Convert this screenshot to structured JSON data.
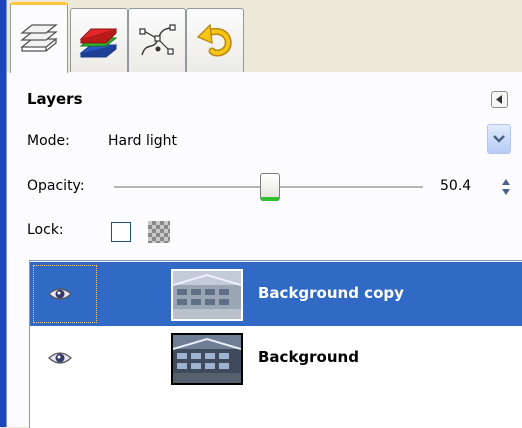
{
  "tabs": [
    {
      "name": "layers",
      "icon": "layers-stack-icon",
      "active": true
    },
    {
      "name": "channels",
      "icon": "channels-icon",
      "active": false
    },
    {
      "name": "paths",
      "icon": "paths-icon",
      "active": false
    },
    {
      "name": "undo",
      "icon": "undo-history-icon",
      "active": false
    }
  ],
  "panel": {
    "title": "Layers",
    "mode_label": "Mode:",
    "mode_value": "Hard light",
    "opacity_label": "Opacity:",
    "opacity_value": "50.4",
    "opacity_fraction": 0.504,
    "lock_label": "Lock:"
  },
  "layers": [
    {
      "name": "Background copy",
      "visible": true,
      "selected": true
    },
    {
      "name": "Background",
      "visible": true,
      "selected": false
    }
  ],
  "colors": {
    "selection": "#316ac5",
    "accent_tab": "#ffc83c",
    "slider_indicator": "#2ec02e"
  }
}
